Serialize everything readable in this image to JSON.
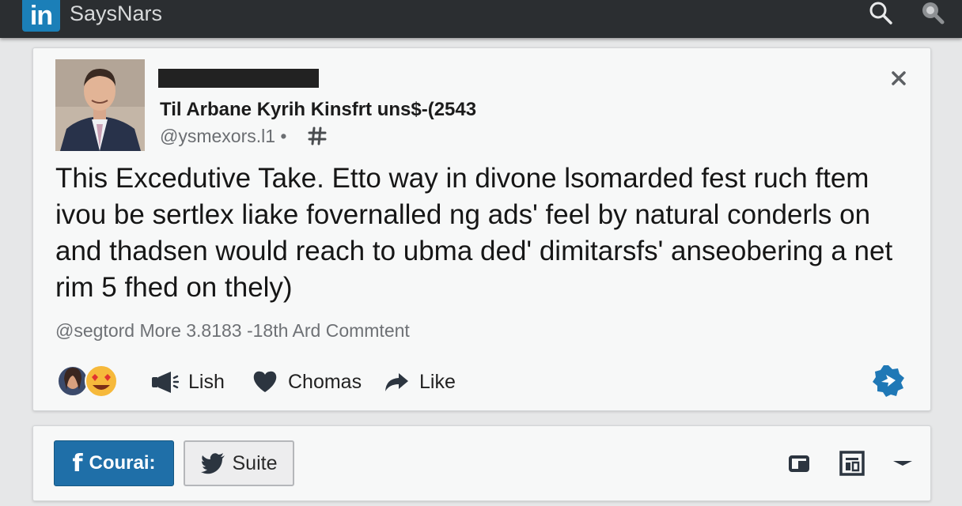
{
  "app": {
    "logo_text": "in",
    "brand": "SaysNars"
  },
  "post": {
    "author_name": "Til Arbane Kyrih Kinsfrt uns$-(2543",
    "handle": "@ysmexors.l1 •",
    "body": "This Excedutive Take. Etto way in divone lsomarded fest ruch ftem ivou be sertlex liake fovernalled ng ads' feel by natural conderls on and thadsen would reach to ubma ded' dimitarsfs' anseobering a net rim 5 fhed on thely)",
    "meta": "@segtord  More 3.8183 -18th Ard Commtent",
    "actions": [
      {
        "label": "Lish",
        "icon": "megaphone-icon"
      },
      {
        "label": "Chomas",
        "icon": "heart-icon"
      },
      {
        "label": "Like",
        "icon": "share-arrow-icon"
      }
    ]
  },
  "share": {
    "facebook_label": "Courai:",
    "twitter_label": "Suite"
  },
  "colors": {
    "topbar": "#2b2e31",
    "brand_blue": "#1b7fb8",
    "facebook_blue": "#1f6fa8",
    "card_bg": "#f7f8f8",
    "badge_blue": "#1f78b6"
  }
}
